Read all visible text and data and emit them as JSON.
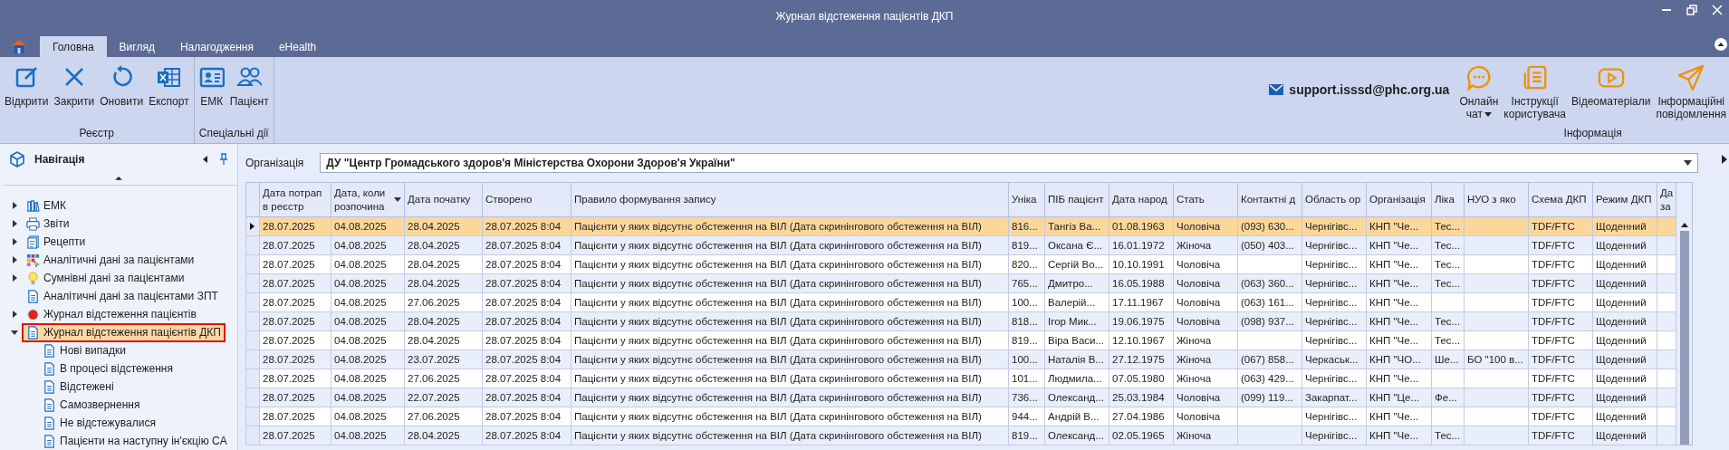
{
  "window": {
    "title": "Журнал відстеження пацієнтів ДКП"
  },
  "ribbon": {
    "tabs": [
      {
        "label": "Головна",
        "selected": true
      },
      {
        "label": "Вигляд",
        "selected": false
      },
      {
        "label": "Налагодження",
        "selected": false
      },
      {
        "label": "eHealth",
        "selected": false
      }
    ],
    "groups": [
      {
        "label": "Реєстр",
        "buttons": [
          {
            "label": "Відкрити"
          },
          {
            "label": "Закрити"
          },
          {
            "label": "Оновити"
          },
          {
            "label": "Експорт"
          }
        ]
      },
      {
        "label": "Спеціальні дії",
        "buttons": [
          {
            "label": "ЕМК"
          },
          {
            "label": "Пацієнт"
          }
        ]
      }
    ],
    "email": "support.isssd@phc.org.ua",
    "info_group": {
      "label": "Інформація",
      "buttons": [
        {
          "label": "Онлайн чат",
          "dropdown": true
        },
        {
          "label": "Інструкції користувача",
          "dropdown": false
        },
        {
          "label": "Відеоматеріали",
          "dropdown": false
        },
        {
          "label": "Інформаційні повідомлення",
          "dropdown": false
        }
      ]
    }
  },
  "sidebar": {
    "title": "Навігація",
    "items": [
      {
        "label": "ЕМК",
        "expanded": false,
        "selected": false
      },
      {
        "label": "Звіти",
        "expanded": false,
        "selected": false
      },
      {
        "label": "Рецепти",
        "expanded": false,
        "selected": false
      },
      {
        "label": "Аналітичні дані за пацієнтами",
        "expanded": false,
        "selected": false
      },
      {
        "label": "Сумнівні дані за пацієнтами",
        "expanded": false,
        "selected": false
      },
      {
        "label": "Аналітичні дані за пацієнтами ЗПТ",
        "selected": false
      },
      {
        "label": "Журнал відстеження пацієнтів",
        "expanded": false,
        "selected": false
      },
      {
        "label": "Журнал відстеження пацієнтів ДКП",
        "expanded": true,
        "selected": true,
        "children": [
          {
            "label": "Нові випадки",
            "selected": false
          },
          {
            "label": "В процесі відстеження",
            "selected": false
          },
          {
            "label": "Відстежені",
            "selected": false
          },
          {
            "label": "Самозвернення",
            "selected": false
          },
          {
            "label": "Не відстежувалися",
            "selected": false
          },
          {
            "label": "Пацієнти на наступну ін'єкцію CA",
            "selected": false
          }
        ]
      }
    ]
  },
  "filter": {
    "label": "Організація",
    "value": "ДУ \"Центр Громадського здоров'я Міністерства Охорони Здоров'я України\""
  },
  "table": {
    "columns": [
      {
        "label": "Дата потрап\nв реєстр",
        "sorted": false
      },
      {
        "label": "Дата, коли\nрозпочина",
        "sorted": true
      },
      {
        "label": "Дата початку",
        "sorted": false
      },
      {
        "label": "Створено",
        "sorted": false
      },
      {
        "label": "Правило формування запису",
        "sorted": false
      },
      {
        "label": "Уніка",
        "sorted": false
      },
      {
        "label": "ПІБ пацієнт",
        "sorted": false
      },
      {
        "label": "Дата народ",
        "sorted": false
      },
      {
        "label": "Стать",
        "sorted": false
      },
      {
        "label": "Контактні д",
        "sorted": false
      },
      {
        "label": "Область ор",
        "sorted": false
      },
      {
        "label": "Організація",
        "sorted": false
      },
      {
        "label": "Ліка",
        "sorted": false
      },
      {
        "label": "НУО з яко",
        "sorted": false
      },
      {
        "label": "Схема ДКП",
        "sorted": false
      },
      {
        "label": "Режим ДКП",
        "sorted": false
      },
      {
        "label": "Да\nза",
        "sorted": false
      }
    ],
    "rows": [
      {
        "selected": true,
        "cells": [
          "28.07.2025",
          "04.08.2025",
          "28.04.2025",
          "28.07.2025 8:04",
          "Пацієнти у яких відсутнє обстеження на ВІЛ (Дата скринінгового обстеження на ВІЛ)",
          "816...",
          "Тангіз Ва...",
          "01.08.1963",
          "Чоловіча",
          "(093) 630...",
          "Чернігівс...",
          "КНП \"Че...",
          "Тес...",
          null,
          "TDF/FTC",
          "Щоденний",
          null
        ]
      },
      {
        "selected": false,
        "cells": [
          "28.07.2025",
          "04.08.2025",
          "28.04.2025",
          "28.07.2025 8:04",
          "Пацієнти у яких відсутнє обстеження на ВІЛ (Дата скринінгового обстеження на ВІЛ)",
          "819...",
          "Оксана Є...",
          "16.01.1972",
          "Жіноча",
          "(050) 403...",
          "Чернігівс...",
          "КНП \"Че...",
          "Тес...",
          null,
          "TDF/FTC",
          "Щоденний",
          null
        ]
      },
      {
        "selected": false,
        "cells": [
          "28.07.2025",
          "04.08.2025",
          "28.04.2025",
          "28.07.2025 8:04",
          "Пацієнти у яких відсутнє обстеження на ВІЛ (Дата скринінгового обстеження на ВІЛ)",
          "820...",
          "Сергій Во...",
          "10.10.1991",
          "Чоловіча",
          null,
          "Чернігівс...",
          "КНП \"Че...",
          "Тес...",
          null,
          "TDF/FTC",
          "Щоденний",
          null
        ]
      },
      {
        "selected": false,
        "cells": [
          "28.07.2025",
          "04.08.2025",
          "28.04.2025",
          "28.07.2025 8:04",
          "Пацієнти у яких відсутнє обстеження на ВІЛ (Дата скринінгового обстеження на ВІЛ)",
          "765...",
          "Дмитро...",
          "16.05.1988",
          "Чоловіча",
          "(063) 360...",
          "Чернігівс...",
          "КНП \"Че...",
          "Тес...",
          null,
          "TDF/FTC",
          "Щоденний",
          null
        ]
      },
      {
        "selected": false,
        "cells": [
          "28.07.2025",
          "04.08.2025",
          "27.06.2025",
          "28.07.2025 8:04",
          "Пацієнти у яких відсутнє обстеження на ВІЛ (Дата скринінгового обстеження на ВІЛ)",
          "100...",
          "Валерій...",
          "17.11.1967",
          "Чоловіча",
          "(063) 161...",
          "Чернігівс...",
          "КНП \"Че...",
          null,
          null,
          "TDF/FTC",
          "Щоденний",
          null
        ]
      },
      {
        "selected": false,
        "cells": [
          "28.07.2025",
          "04.08.2025",
          "28.04.2025",
          "28.07.2025 8:04",
          "Пацієнти у яких відсутнє обстеження на ВІЛ (Дата скринінгового обстеження на ВІЛ)",
          "818...",
          "Ігор Мик...",
          "19.06.1975",
          "Чоловіча",
          "(098) 937...",
          "Чернігівс...",
          "КНП \"Че...",
          "Тес...",
          null,
          "TDF/FTC",
          "Щоденний",
          null
        ]
      },
      {
        "selected": false,
        "cells": [
          "28.07.2025",
          "04.08.2025",
          "28.04.2025",
          "28.07.2025 8:04",
          "Пацієнти у яких відсутнє обстеження на ВІЛ (Дата скринінгового обстеження на ВІЛ)",
          "819...",
          "Віра Васи...",
          "12.10.1967",
          "Жіноча",
          null,
          "Чернігівс...",
          "КНП \"Че...",
          "Тес...",
          null,
          "TDF/FTC",
          "Щоденний",
          null
        ]
      },
      {
        "selected": false,
        "cells": [
          "28.07.2025",
          "04.08.2025",
          "23.07.2025",
          "28.07.2025 8:04",
          "Пацієнти у яких відсутнє обстеження на ВІЛ (Дата скринінгового обстеження на ВІЛ)",
          "100...",
          "Наталія В...",
          "27.12.1975",
          "Жіноча",
          "(067) 858...",
          "Черкаськ...",
          "КНП \"ЧО...",
          "Ше...",
          "БО \"100 в...",
          "TDF/FTC",
          "Щоденний",
          null
        ]
      },
      {
        "selected": false,
        "cells": [
          "28.07.2025",
          "04.08.2025",
          "27.06.2025",
          "28.07.2025 8:04",
          "Пацієнти у яких відсутнє обстеження на ВІЛ (Дата скринінгового обстеження на ВІЛ)",
          "101...",
          "Людмила...",
          "07.05.1980",
          "Жіноча",
          "(063) 429...",
          "Чернігівс...",
          "КНП \"Че...",
          null,
          null,
          "TDF/FTC",
          "Щоденний",
          null
        ]
      },
      {
        "selected": false,
        "cells": [
          "28.07.2025",
          "04.08.2025",
          "22.07.2025",
          "28.07.2025 8:04",
          "Пацієнти у яких відсутнє обстеження на ВІЛ (Дата скринінгового обстеження на ВІЛ)",
          "736...",
          "Олександ...",
          "25.03.1984",
          "Чоловіча",
          "(099) 119...",
          "Закарпат...",
          "КНП \"Це...",
          "Фе...",
          null,
          "TDF/FTC",
          "Щоденний",
          null
        ]
      },
      {
        "selected": false,
        "cells": [
          "28.07.2025",
          "04.08.2025",
          "27.06.2025",
          "28.07.2025 8:04",
          "Пацієнти у яких відсутнє обстеження на ВІЛ (Дата скринінгового обстеження на ВІЛ)",
          "944...",
          "Андрій В...",
          "27.04.1986",
          "Чоловіча",
          null,
          "Чернігівс...",
          "КНП \"Че...",
          null,
          null,
          "TDF/FTC",
          "Щоденний",
          null
        ]
      },
      {
        "selected": false,
        "cells": [
          "28.07.2025",
          "04.08.2025",
          "28.04.2025",
          "28.07.2025 8:04",
          "Пацієнти у яких відсутнє обстеження на ВІЛ (Дата скринінгового обстеження на ВІЛ)",
          "819...",
          "Олександ...",
          "02.05.1965",
          "Жіноча",
          null,
          "Чернігівс...",
          "КНП \"Че...",
          "Тес...",
          null,
          "TDF/FTC",
          "Щоденний",
          null
        ]
      }
    ]
  }
}
